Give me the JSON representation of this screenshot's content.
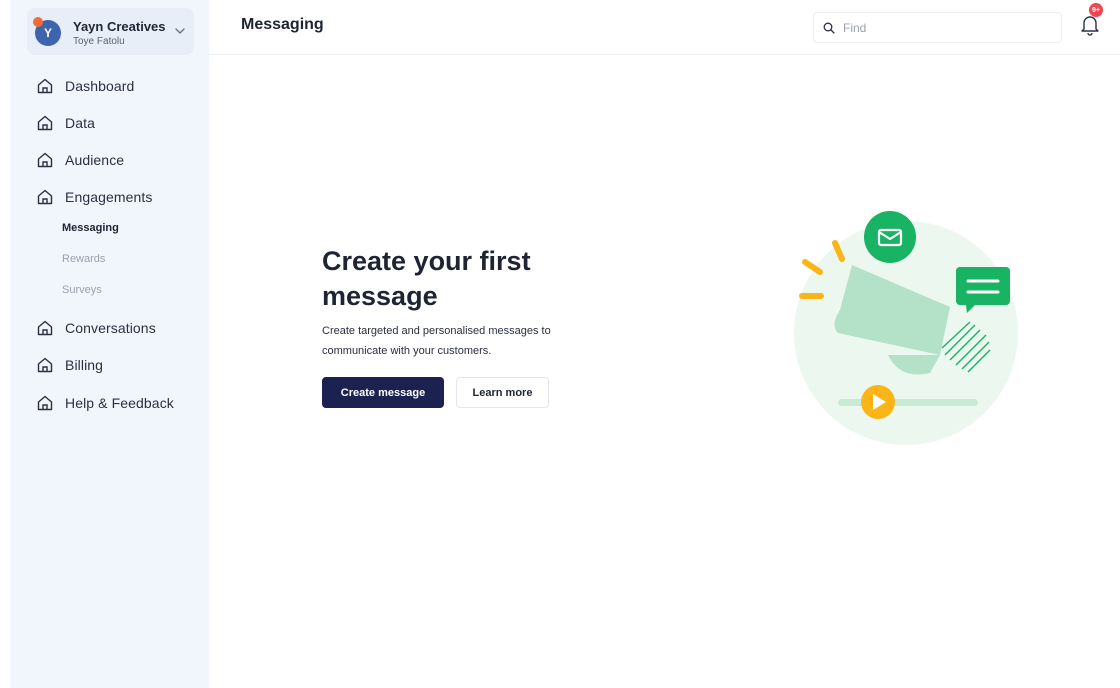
{
  "workspace": {
    "avatar_initial": "Y",
    "name": "Yayn Creatives",
    "user": "Toye Fatolu"
  },
  "sidebar": {
    "items": [
      {
        "label": "Dashboard",
        "icon": "home-icon"
      },
      {
        "label": "Data",
        "icon": "home-icon"
      },
      {
        "label": "Audience",
        "icon": "home-icon"
      },
      {
        "label": "Engagements",
        "icon": "home-icon"
      },
      {
        "label": "Conversations",
        "icon": "home-icon"
      },
      {
        "label": "Billing",
        "icon": "home-icon"
      },
      {
        "label": "Help & Feedback",
        "icon": "home-icon"
      }
    ],
    "engagements_sub": [
      {
        "label": "Messaging",
        "active": true
      },
      {
        "label": "Rewards",
        "active": false
      },
      {
        "label": "Surveys",
        "active": false
      }
    ]
  },
  "header": {
    "title": "Messaging",
    "search_placeholder": "Find",
    "notification_badge": "9+"
  },
  "empty_state": {
    "title": "Create your first message",
    "description": "Create targeted and personalised messages to communicate with your customers.",
    "primary_button": "Create  message",
    "secondary_button": "Learn more"
  },
  "colors": {
    "sidebar_bg": "#f1f5fc",
    "primary": "#1b2151",
    "accent_green": "#19b364",
    "accent_yellow": "#fbb518",
    "badge_red": "#ef4650"
  }
}
